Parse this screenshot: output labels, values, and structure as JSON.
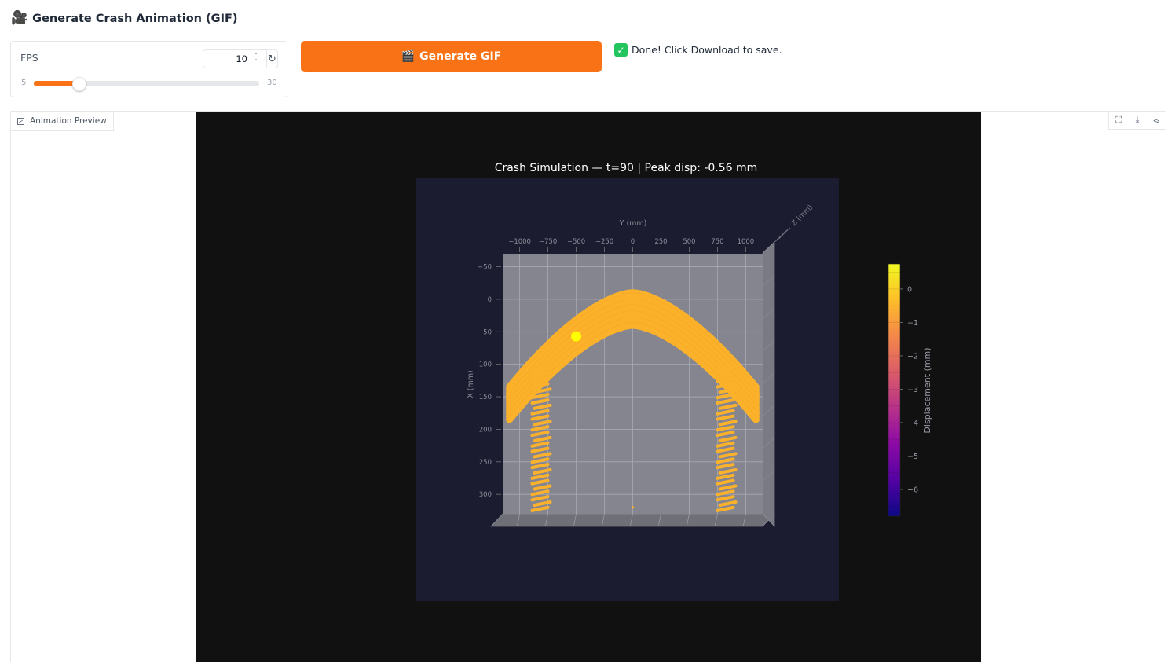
{
  "header": {
    "icon": "🎥",
    "title": "Generate Crash Animation (GIF)"
  },
  "fps": {
    "label": "FPS",
    "value": "10",
    "min": "5",
    "max": "30",
    "slider_value": 10,
    "reset_icon": "↻",
    "spin_up": "˄",
    "spin_down": "˅"
  },
  "generate_button": {
    "icon": "🎬",
    "label": "Generate GIF",
    "color": "#f97316"
  },
  "status": {
    "icon": "✓",
    "text": "Done! Click Download to save."
  },
  "preview": {
    "label": "Animation Preview",
    "tools": {
      "fullscreen": "⛶",
      "download": "⤓",
      "share": "⋖"
    }
  },
  "chart_data": {
    "type": "scatter",
    "title": "Crash Simulation — t=90  |  Peak disp: -0.56 mm",
    "xlabel": "Y (mm)",
    "ylabel": "X (mm)",
    "zlabel": "Z (mm)",
    "x_ticks": [
      "−1000",
      "−750",
      "−500",
      "−250",
      "0",
      "250",
      "500",
      "750",
      "1000"
    ],
    "y_ticks": [
      "−50",
      "0",
      "50",
      "100",
      "150",
      "200",
      "250",
      "300"
    ],
    "xlim": [
      -1150,
      1150
    ],
    "ylim": [
      -70,
      330
    ],
    "colorbar": {
      "label": "Displacement (mm)",
      "ticks": [
        "0",
        "−1",
        "−2",
        "−3",
        "−4",
        "−5",
        "−6"
      ],
      "range": [
        -6.8,
        0.75
      ],
      "colormap": [
        "#0d0887",
        "#5302a3",
        "#8b0aa5",
        "#b83289",
        "#db5c68",
        "#f48849",
        "#febd2a",
        "#f0f921"
      ]
    },
    "series": [
      {
        "type": "arch",
        "y_range": [
          -1090,
          1090
        ],
        "x_crown_outer": -10,
        "x_crown_inner": 40,
        "x_foot": 135,
        "layers": 12,
        "displacement": -0.1
      },
      {
        "type": "pillar",
        "y_center": -820,
        "x_range": [
          110,
          325
        ],
        "rows": 27,
        "displacement": -0.1
      },
      {
        "type": "pillar",
        "y_center": 820,
        "x_range": [
          110,
          325
        ],
        "rows": 27,
        "displacement": -0.1
      }
    ],
    "points": [
      {
        "y": -500,
        "x": 57,
        "displacement": 0.5
      },
      {
        "y": 0,
        "x": 320,
        "displacement": 0.0
      }
    ],
    "colors": {
      "figure_bg": "#111111",
      "axes_bg": "#1c1c30",
      "pane": "#858590",
      "data": "#fcb12b",
      "marker": "#ffff00"
    }
  }
}
